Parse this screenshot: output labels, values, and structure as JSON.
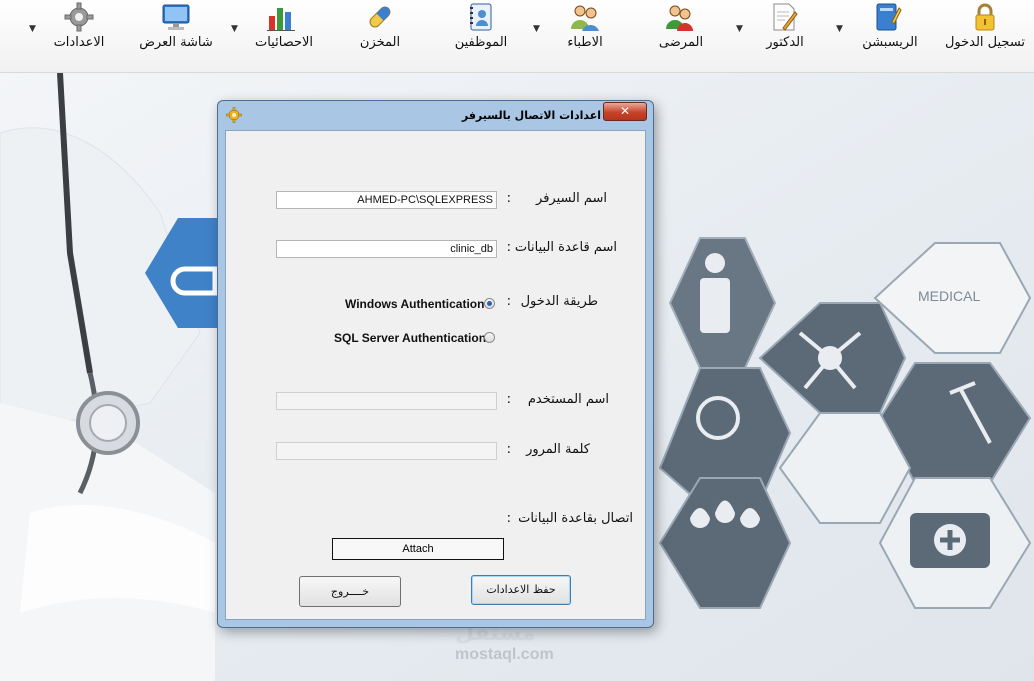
{
  "toolbar": {
    "items": [
      {
        "label": "تسجيل الدخول",
        "icon": "lock-icon",
        "dropdown": false
      },
      {
        "label": "الريسبشن",
        "icon": "notebook-icon",
        "dropdown": true
      },
      {
        "label": "الدكتور",
        "icon": "pencil-document-icon",
        "dropdown": true
      },
      {
        "label": "المرضى",
        "icon": "patients-icon",
        "dropdown": false
      },
      {
        "label": "الاطباء",
        "icon": "doctors-icon",
        "dropdown": true
      },
      {
        "label": "الموظفين",
        "icon": "contacts-book-icon",
        "dropdown": false
      },
      {
        "label": "المخزن",
        "icon": "capsule-icon",
        "dropdown": false
      },
      {
        "label": "الاحصائيات",
        "icon": "bar-chart-icon",
        "dropdown": true
      },
      {
        "label": "شاشة العرض",
        "icon": "monitor-icon",
        "dropdown": false
      },
      {
        "label": "الاعدادات",
        "icon": "gear-icon",
        "dropdown": true
      }
    ]
  },
  "background": {
    "medical_text": "MEDICAL",
    "watermark_arabic": "مستقل",
    "watermark": "mostaql.com"
  },
  "dialog": {
    "title": "اعدادات الاتصال بالسيرفر",
    "close_label": "✕",
    "server": {
      "label": "اسم السيرفر",
      "value": "AHMED-PC\\SQLEXPRESS"
    },
    "database": {
      "label": "اسم قاعدة البيانات",
      "value": "clinic_db"
    },
    "auth": {
      "label": "طريقة الدخول",
      "options": [
        {
          "label": "Windows Authentication",
          "checked": true
        },
        {
          "label": "SQL Server Authentication",
          "checked": false
        }
      ]
    },
    "username": {
      "label": "اسم المستخدم",
      "value": ""
    },
    "password": {
      "label": "كلمة المرور",
      "value": ""
    },
    "attach": {
      "label": "اتصال بقاعدة البيانات",
      "button_label": "Attach"
    },
    "save_label": "حفظ الاعدادات",
    "exit_label": "خــــروج"
  },
  "colors": {
    "accent": "#2a62b5",
    "close": "#c7432a",
    "hex": "#3f82c7"
  }
}
